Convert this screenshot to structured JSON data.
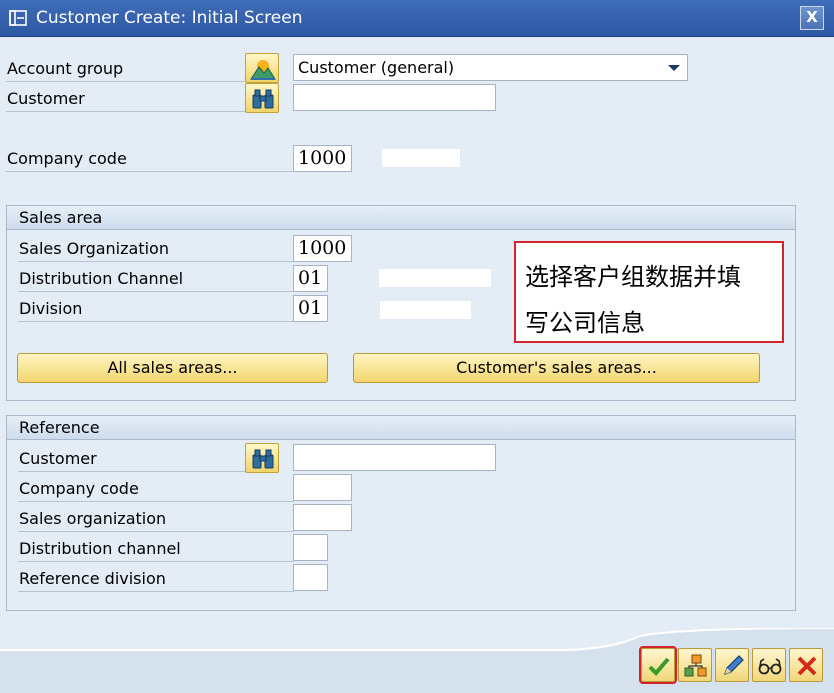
{
  "window": {
    "title": "Customer Create: Initial Screen",
    "close_label": "X"
  },
  "header_fields": {
    "account_group": {
      "label": "Account group",
      "value": "Customer (general)"
    },
    "customer": {
      "label": "Customer",
      "value": ""
    },
    "company_code": {
      "label": "Company code",
      "value": "1000"
    }
  },
  "sales_area": {
    "title": "Sales area",
    "sales_org": {
      "label": "Sales Organization",
      "value": "1000"
    },
    "distribution_channel": {
      "label": "Distribution Channel",
      "value": "01"
    },
    "division": {
      "label": "Division",
      "value": "01"
    },
    "all_sales_areas_button": "All sales areas...",
    "customers_sales_areas_button": "Customer's sales areas..."
  },
  "annotation": {
    "line1": "选择客户组数据并填",
    "line2": "写公司信息"
  },
  "reference": {
    "title": "Reference",
    "customer": {
      "label": "Customer",
      "value": ""
    },
    "company_code": {
      "label": "Company code",
      "value": ""
    },
    "sales_organization": {
      "label": "Sales organization",
      "value": ""
    },
    "distribution_channel": {
      "label": "Distribution channel",
      "value": ""
    },
    "reference_division": {
      "label": "Reference division",
      "value": ""
    }
  },
  "toolbar": {
    "icons": [
      "checkmark-icon",
      "org-data-icon",
      "pencil-icon",
      "glasses-icon",
      "cancel-x-icon"
    ]
  },
  "colors": {
    "accent_red": "#d3232b",
    "title_blue": "#2d58a3"
  }
}
